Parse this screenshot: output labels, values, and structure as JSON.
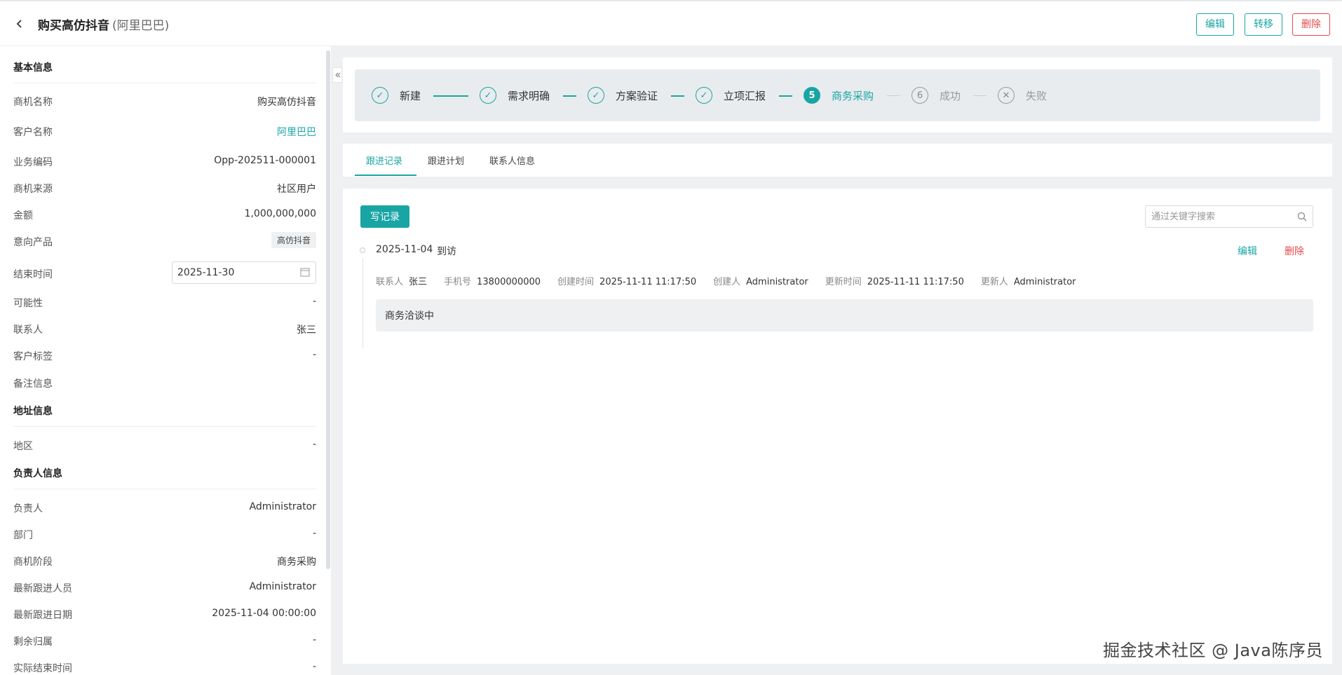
{
  "header": {
    "title": "购买高仿抖音",
    "subtitle": "(阿里巴巴)",
    "edit_label": "编辑",
    "transfer_label": "转移",
    "delete_label": "删除"
  },
  "sidebar": {
    "basic_title": "基本信息",
    "basic": [
      {
        "label": "商机名称",
        "value": "购买高仿抖音"
      },
      {
        "label": "客户名称",
        "value": "阿里巴巴"
      },
      {
        "label": "业务编码",
        "value": "Opp-202511-000001"
      },
      {
        "label": "商机来源",
        "value": "社区用户"
      },
      {
        "label": "金额",
        "value": "1,000,000,000"
      },
      {
        "label": "意向产品",
        "value": "高仿抖音"
      },
      {
        "label": "结束时间",
        "value": "2025-11-30"
      },
      {
        "label": "可能性",
        "value": "-"
      },
      {
        "label": "联系人",
        "value": "张三"
      },
      {
        "label": "客户标签",
        "value": "-"
      },
      {
        "label": "备注信息",
        "value": ""
      }
    ],
    "address_title": "地址信息",
    "address": [
      {
        "label": "地区",
        "value": "-"
      }
    ],
    "owner_title": "负责人信息",
    "owner": [
      {
        "label": "负责人",
        "value": "Administrator"
      },
      {
        "label": "部门",
        "value": "-"
      },
      {
        "label": "商机阶段",
        "value": "商务采购"
      },
      {
        "label": "最新跟进人员",
        "value": "Administrator"
      },
      {
        "label": "最新跟进日期",
        "value": "2025-11-04 00:00:00"
      },
      {
        "label": "剩余归属",
        "value": "-"
      },
      {
        "label": "实际结束时间",
        "value": "-"
      }
    ]
  },
  "steps": {
    "s1": {
      "num": "✓",
      "label": "新建"
    },
    "s2": {
      "num": "✓",
      "label": "需求明确"
    },
    "s3": {
      "num": "✓",
      "label": "方案验证"
    },
    "s4": {
      "num": "✓",
      "label": "立项汇报"
    },
    "s5": {
      "num": "5",
      "label": "商务采购"
    },
    "s6": {
      "num": "6",
      "label": "成功"
    },
    "s7": {
      "num": "✕",
      "label": "失败"
    }
  },
  "tabs": {
    "t1": "跟进记录",
    "t2": "跟进计划",
    "t3": "联系人信息"
  },
  "records": {
    "write_label": "写记录",
    "search_placeholder": "通过关键字搜索",
    "item": {
      "date": "2025-11-04",
      "type": "到访",
      "edit_label": "编辑",
      "delete_label": "删除",
      "contact_label": "联系人",
      "contact": "张三",
      "phone_label": "手机号",
      "phone": "13800000000",
      "created_label": "创建时间",
      "created": "2025-11-11 11:17:50",
      "creator_label": "创建人",
      "creator": "Administrator",
      "updated_label": "更新时间",
      "updated": "2025-11-11 11:17:50",
      "updater_label": "更新人",
      "updater": "Administrator",
      "note": "商务洽谈中"
    }
  },
  "watermark": "掘金技术社区 @ Java陈序员",
  "colors": {
    "accent": "#1aa5a5",
    "danger": "#e34848"
  }
}
